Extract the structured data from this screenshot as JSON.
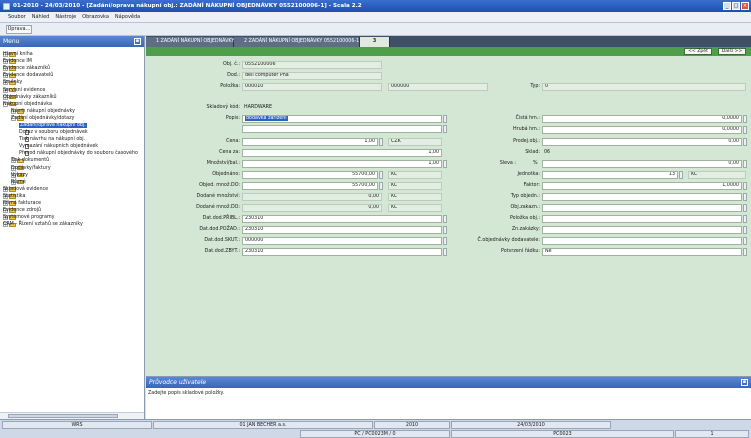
{
  "window": {
    "title": "01-2010 - 24/03/2010 - [Zadání/oprava nákupní obj.: ZADÁNÍ NÁKUPNÍ OBJEDNÁVKY 0552100006-1] - Scala 2.2"
  },
  "menu": [
    "Soubor",
    "Náhled",
    "Nástroje",
    "Obrazovka",
    "Nápověda"
  ],
  "toolbar": {
    "edit_label": "Úprava..."
  },
  "navigator": {
    "title": "Menu",
    "items": [
      {
        "label": "Hlavní kniha",
        "level": 0,
        "type": "folder",
        "exp": "+"
      },
      {
        "label": "Evidence IM",
        "level": 0,
        "type": "folder",
        "exp": "+"
      },
      {
        "label": "Evidence zákazníků",
        "level": 0,
        "type": "folder",
        "exp": "+"
      },
      {
        "label": "Evidence dodavatelů",
        "level": 0,
        "type": "folder",
        "exp": "+"
      },
      {
        "label": "Směnky",
        "level": 0,
        "type": "folder",
        "exp": "+"
      },
      {
        "label": "Servisní evidence",
        "level": 0,
        "type": "folder",
        "exp": "+"
      },
      {
        "label": "Objednávky zákazníků",
        "level": 0,
        "type": "folder",
        "exp": "+"
      },
      {
        "label": "Nákupní objednávka",
        "level": 0,
        "type": "folder",
        "exp": "-"
      },
      {
        "label": "Návrh nákupní objednávky",
        "level": 1,
        "type": "folder",
        "exp": "+"
      },
      {
        "label": "Zadání objednávky/dotazy",
        "level": 1,
        "type": "folder",
        "exp": "-"
      },
      {
        "label": "Zadání/oprava nákupní obj.",
        "level": 2,
        "type": "doc",
        "selected": true
      },
      {
        "label": "Dotaz v souboru objednávek",
        "level": 2,
        "type": "doc"
      },
      {
        "label": "Tisk návrhu na nákupní obj.",
        "level": 2,
        "type": "doc"
      },
      {
        "label": "Vymazání nákupních objednávek",
        "level": 2,
        "type": "doc"
      },
      {
        "label": "Převod nákupní objednávky do souboru časového",
        "level": 2,
        "type": "doc"
      },
      {
        "label": "Tisk dokumentů",
        "level": 1,
        "type": "folder",
        "exp": "+"
      },
      {
        "label": "Dodávky/faktury",
        "level": 1,
        "type": "folder",
        "exp": "+"
      },
      {
        "label": "Výkazy",
        "level": 1,
        "type": "folder",
        "exp": "+"
      },
      {
        "label": "Různé",
        "level": 1,
        "type": "folder",
        "exp": "+"
      },
      {
        "label": "Skladová evidence",
        "level": 0,
        "type": "folder",
        "exp": "+"
      },
      {
        "label": "Statistika",
        "level": 0,
        "type": "folder",
        "exp": "+"
      },
      {
        "label": "Přímá fakturace",
        "level": 0,
        "type": "folder",
        "exp": "+"
      },
      {
        "label": "Evidence zdrojů",
        "level": 0,
        "type": "folder",
        "exp": "+"
      },
      {
        "label": "Systémové programy",
        "level": 0,
        "type": "folder",
        "exp": "+"
      },
      {
        "label": "CRM - Řízení vztahů se zákazníky",
        "level": 0,
        "type": "folder",
        "exp": "+"
      }
    ]
  },
  "tabs": [
    "1 ZADÁNÍ NÁKUPNÍ OBJEDNÁVKY",
    "2 ZADÁNÍ NÁKUPNÍ OBJEDNÁVKY 0552100006-1",
    "3"
  ],
  "nav_buttons": {
    "back": "<< Zpět",
    "next": "Další >>"
  },
  "form": {
    "obj_c_label": "Obj. č.:",
    "obj_c": "0552100006",
    "dod_label": "Dod.:",
    "dod": "dell computer Pha",
    "polozka_label": "Položka:",
    "polozka": "000010",
    "polozka2": "000000",
    "typ_label": "Typ:",
    "typ": "0",
    "skladovy_kod_label": "Skladový kód:",
    "skladovy_kod": "HARDWARE",
    "popis_label": "Popis:",
    "popis": "dodávka zařízení",
    "cena_label": "Cena:",
    "cena": "1,00",
    "cena_mena": "CZK",
    "cena_za_label": "Cena za:",
    "cena_za": "1,00",
    "mnozstvi_label": "Množství/bal.:",
    "mnozstvi": "1,00",
    "objednano_label": "Objednáno:",
    "objednano": "55700,00",
    "objednano_j": "KČ",
    "objed_mnoz_label": "Objed. množ.DO:",
    "objed_mnoz": "55700,00",
    "objed_mnoz_j": "KČ",
    "dodane_mnozstvi_label": "Dodané množství:",
    "dodane_mnozstvi": "0,00",
    "dodane_mnozstvi_j": "KČ",
    "dodane_mnoz_do_label": "Dodané množ.DO:",
    "dodane_mnoz_do": "0,00",
    "dodane_mnoz_do_j": "KČ",
    "dat_pribl_label": "Dat.dod.PŘIBL.:",
    "dat_pribl": "230310",
    "dat_pozad_label": "Dat.dod.POŽAD.:",
    "dat_pozad": "230310",
    "dat_skut_label": "Dat.dod.SKUT.:",
    "dat_skut": "000000",
    "dat_zbyt_label": "Dat.dod.ZBYT.:",
    "dat_zbyt": "230310",
    "cista_hm_label": "Čistá hm.:",
    "cista_hm": "0,0000",
    "hruba_hm_label": "Hrubá hm.:",
    "hruba_hm": "0,0000",
    "prodej_obj_label": "Prodej.obj.:",
    "prodej_obj": "0,00",
    "sklad_label": "Sklad:",
    "sklad": "06",
    "sleva_label": "Sleva :",
    "sleva_unit": "%",
    "sleva": "0,00",
    "jednotka_label": "Jednotka:",
    "jednotka": "13",
    "jednotka_j": "KČ",
    "faktor_label": "Faktor:",
    "faktor": "1,0000",
    "typ_objedn_label": "Typ objedn.:",
    "typ_objedn": "",
    "obj_zakazn_label": "Obj.zakazn.:",
    "obj_zakazn": "",
    "polozka_obj_label": "Položka obj.:",
    "polozka_obj": "",
    "zn_zakazky_label": "Zn.zakázky:",
    "zn_zakazky": "",
    "c_obj_dod_label": "Č.objednávky dodavatele:",
    "c_obj_dod": "",
    "potvrzeni_label": "Potvrzení řádku:",
    "potvrzeni": "Ne"
  },
  "guide": {
    "title": "Průvodce uživatele",
    "text": "Zadejte popis skladové položky."
  },
  "status": {
    "c1": "WRS",
    "c2": "01 JAN BECHER a.s.",
    "c3": "2010",
    "c4": "24/03/2010",
    "c5": "PC / PC0023M / 0",
    "c6": "PC0023",
    "c7": "1"
  }
}
